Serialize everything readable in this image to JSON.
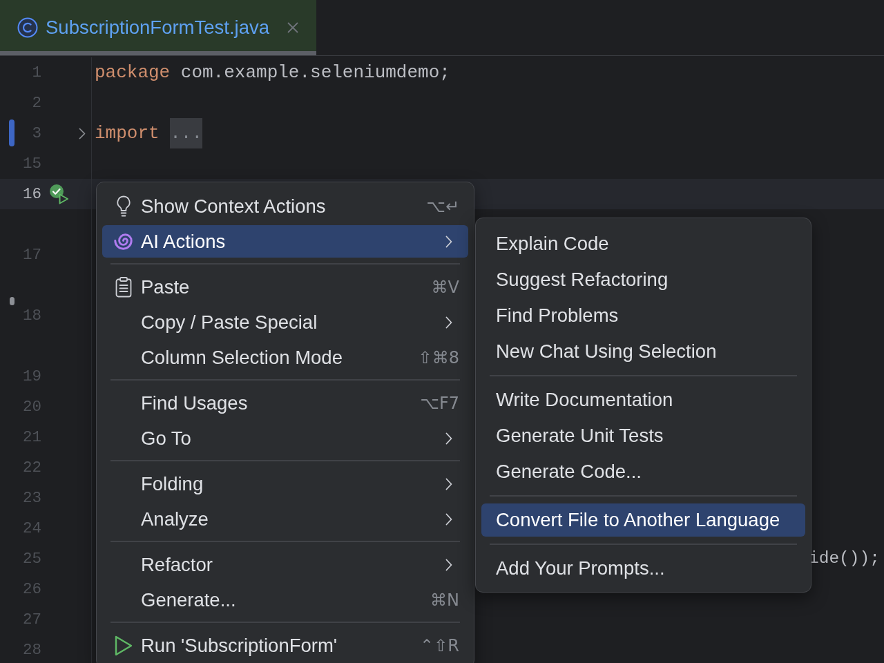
{
  "tab": {
    "title": "SubscriptionFormTest.java",
    "selected": true
  },
  "editor": {
    "lines": [
      {
        "number": "1",
        "kind": "code",
        "current": false,
        "modified": false,
        "folded": false,
        "run": false,
        "marked": false,
        "tokens": [
          {
            "kind": "keyword",
            "text": "package"
          },
          {
            "kind": "plain",
            "text": "com.example.seleniumdemo;"
          }
        ]
      },
      {
        "number": "2",
        "kind": "code",
        "current": false,
        "modified": false,
        "folded": false,
        "run": false,
        "marked": false
      },
      {
        "number": "3",
        "kind": "code",
        "current": false,
        "modified": true,
        "folded": true,
        "run": false,
        "marked": false,
        "tokens": [
          {
            "kind": "keyword",
            "text": "import"
          },
          {
            "kind": "fold",
            "text": "..."
          }
        ]
      },
      {
        "number": "15",
        "kind": "code",
        "current": false,
        "modified": false,
        "folded": false,
        "run": false,
        "marked": false
      },
      {
        "number": "16",
        "kind": "code",
        "current": true,
        "modified": false,
        "folded": false,
        "run": true,
        "marked": false
      },
      {
        "number": "17",
        "kind": "hinted",
        "current": false,
        "modified": false,
        "folded": false,
        "run": false,
        "marked": false
      },
      {
        "number": "18",
        "kind": "hinted",
        "current": false,
        "modified": false,
        "folded": false,
        "run": false,
        "marked": true
      },
      {
        "number": "19",
        "kind": "hinted",
        "current": false,
        "modified": false,
        "folded": false,
        "run": false,
        "marked": false
      },
      {
        "number": "20",
        "kind": "code",
        "current": false,
        "modified": false,
        "folded": false,
        "run": false,
        "marked": false
      },
      {
        "number": "21",
        "kind": "code",
        "current": false,
        "modified": false,
        "folded": false,
        "run": false,
        "marked": false
      },
      {
        "number": "22",
        "kind": "code",
        "current": false,
        "modified": false,
        "folded": false,
        "run": false,
        "marked": false
      },
      {
        "number": "23",
        "kind": "code",
        "current": false,
        "modified": false,
        "folded": false,
        "run": false,
        "marked": false
      },
      {
        "number": "24",
        "kind": "code",
        "current": false,
        "modified": false,
        "folded": false,
        "run": false,
        "marked": false
      },
      {
        "number": "25",
        "kind": "code",
        "current": false,
        "modified": false,
        "folded": false,
        "run": false,
        "marked": false,
        "tokens": [
          {
            "kind": "tail",
            "text": "ide());"
          }
        ]
      },
      {
        "number": "26",
        "kind": "code",
        "current": false,
        "modified": false,
        "folded": false,
        "run": false,
        "marked": false
      },
      {
        "number": "27",
        "kind": "code",
        "current": false,
        "modified": false,
        "folded": false,
        "run": false,
        "marked": false
      },
      {
        "number": "28",
        "kind": "code",
        "current": false,
        "modified": false,
        "folded": false,
        "run": false,
        "marked": false
      }
    ]
  },
  "context_menu": {
    "items": [
      {
        "kind": "item",
        "label": "Show Context Actions",
        "shortcut": "⌥↵",
        "selected": false
      },
      {
        "kind": "submenu",
        "label": "AI Actions",
        "selected": true
      },
      {
        "kind": "separator"
      },
      {
        "kind": "item",
        "label": "Paste",
        "shortcut": "⌘V",
        "selected": false
      },
      {
        "kind": "submenu",
        "label": "Copy / Paste Special",
        "selected": false
      },
      {
        "kind": "item",
        "label": "Column Selection Mode",
        "shortcut": "⇧⌘8",
        "selected": false
      },
      {
        "kind": "separator"
      },
      {
        "kind": "item",
        "label": "Find Usages",
        "shortcut": "⌥F7",
        "selected": false
      },
      {
        "kind": "submenu",
        "label": "Go To",
        "selected": false
      },
      {
        "kind": "separator"
      },
      {
        "kind": "submenu",
        "label": "Folding",
        "selected": false
      },
      {
        "kind": "submenu",
        "label": "Analyze",
        "selected": false
      },
      {
        "kind": "separator"
      },
      {
        "kind": "submenu",
        "label": "Refactor",
        "selected": false
      },
      {
        "kind": "item",
        "label": "Generate...",
        "shortcut": "⌘N",
        "selected": false
      },
      {
        "kind": "separator"
      },
      {
        "kind": "item",
        "label": "Run 'SubscriptionForm'",
        "shortcut": "⌃⇧R",
        "selected": false
      }
    ]
  },
  "submenu": {
    "items": [
      {
        "kind": "item",
        "label": "Explain Code",
        "selected": false
      },
      {
        "kind": "item",
        "label": "Suggest Refactoring",
        "selected": false
      },
      {
        "kind": "item",
        "label": "Find Problems",
        "selected": false
      },
      {
        "kind": "item",
        "label": "New Chat Using Selection",
        "selected": false
      },
      {
        "kind": "separator"
      },
      {
        "kind": "item",
        "label": "Write Documentation",
        "selected": false
      },
      {
        "kind": "item",
        "label": "Generate Unit Tests",
        "selected": false
      },
      {
        "kind": "item",
        "label": "Generate Code...",
        "selected": false
      },
      {
        "kind": "separator"
      },
      {
        "kind": "item",
        "label": "Convert File to Another Language",
        "selected": true
      },
      {
        "kind": "separator"
      },
      {
        "kind": "item",
        "label": "Add Your Prompts...",
        "selected": false
      }
    ]
  }
}
